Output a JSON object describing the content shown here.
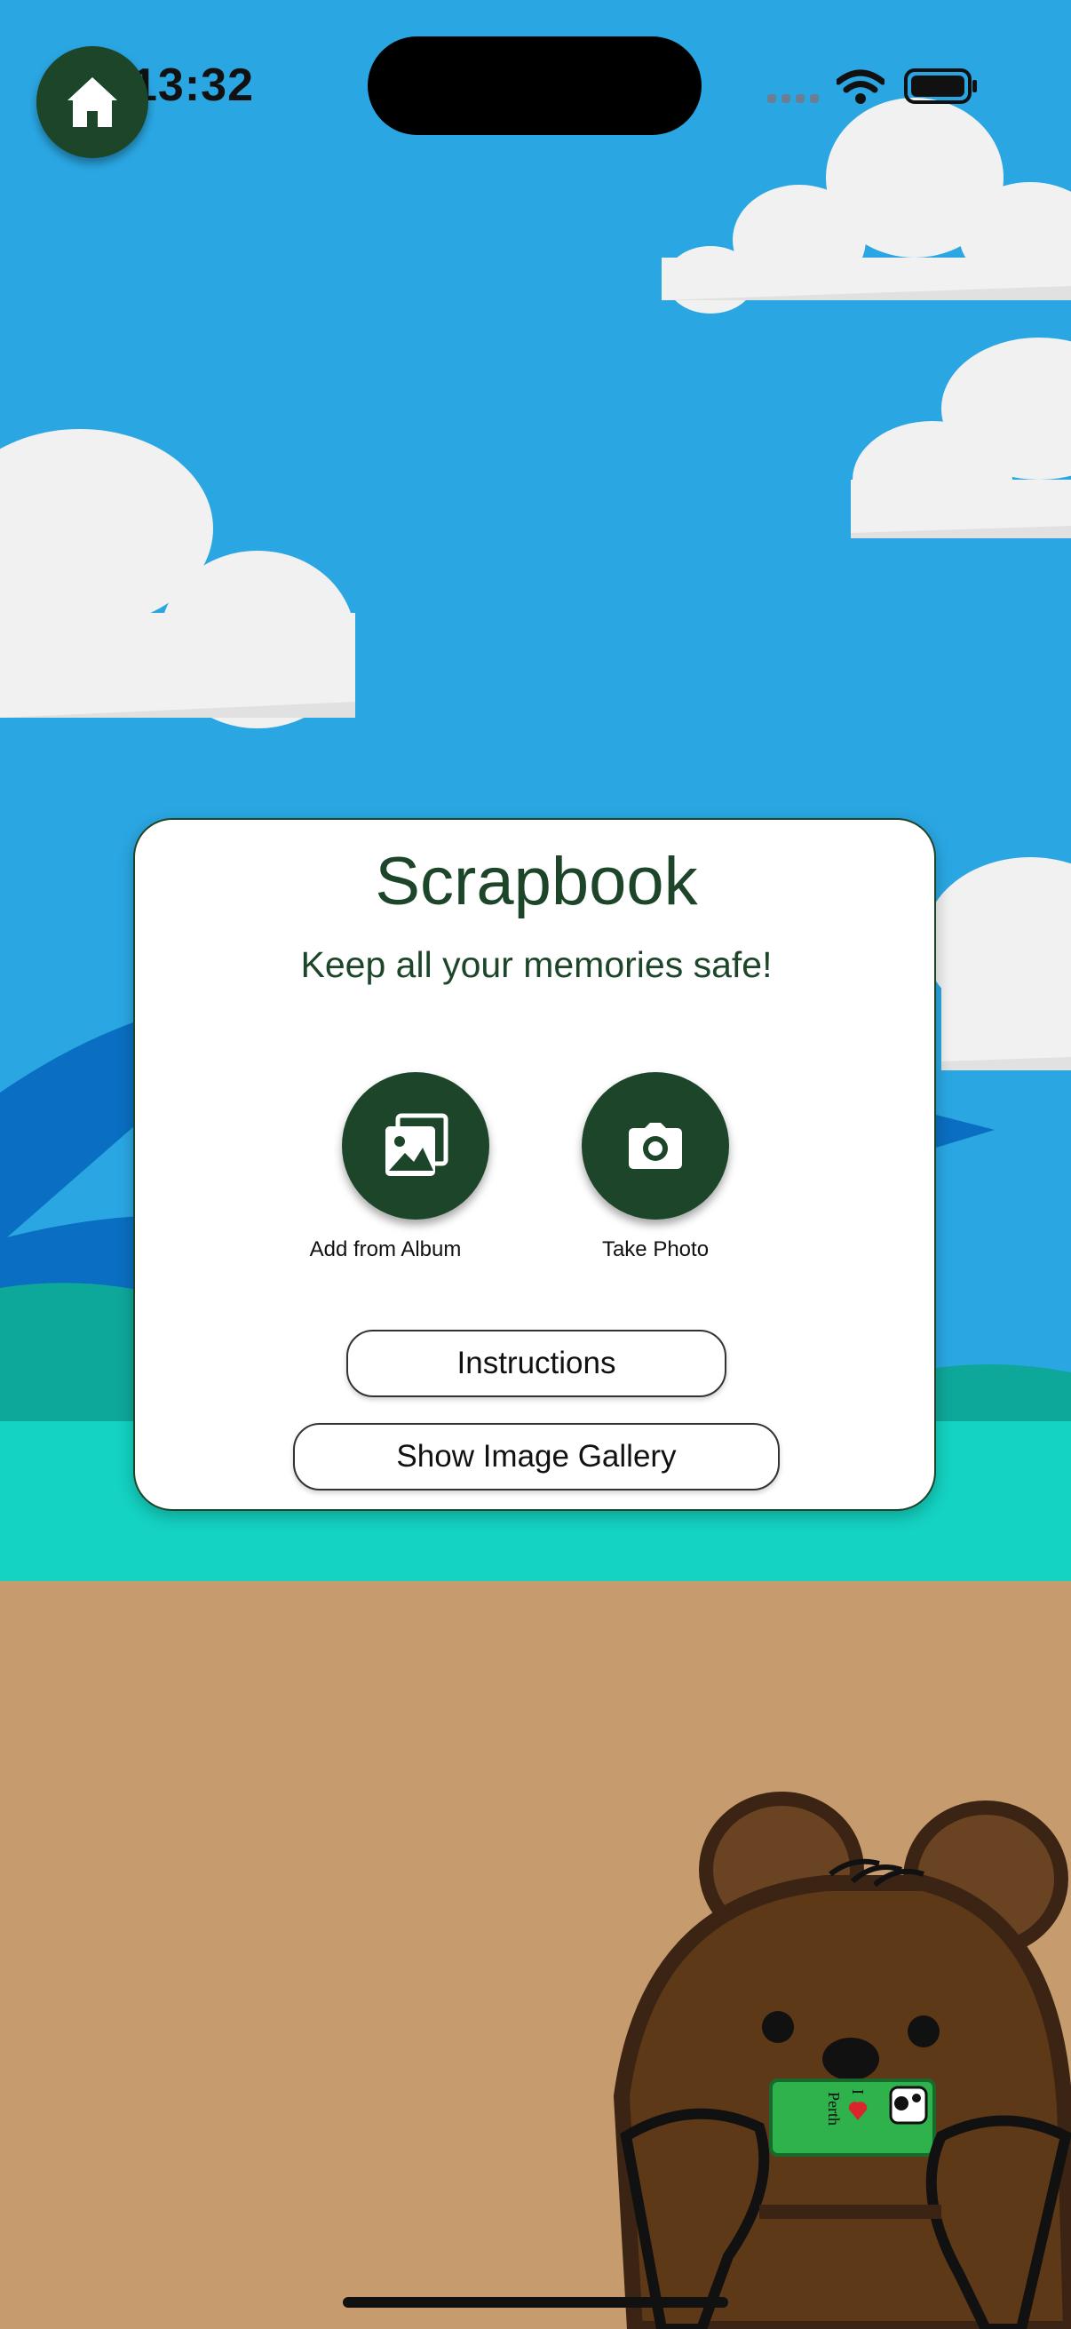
{
  "status_bar": {
    "time": "13:32"
  },
  "nav": {
    "home_icon": "home-icon"
  },
  "card": {
    "title": "Scrapbook",
    "subtitle": "Keep all your memories safe!",
    "actions": [
      {
        "label": "Add from Album",
        "icon": "photo-album-icon"
      },
      {
        "label": "Take Photo",
        "icon": "camera-icon"
      }
    ],
    "instructions_label": "Instructions",
    "gallery_label": "Show Image Gallery"
  },
  "mascot": {
    "phone_text_line1": "I",
    "phone_text_line2": "Perth"
  },
  "colors": {
    "sky": "#2aa7e3",
    "accent": "#1c4529",
    "ground": "#c69b6d",
    "grass": "#14d3c2"
  }
}
